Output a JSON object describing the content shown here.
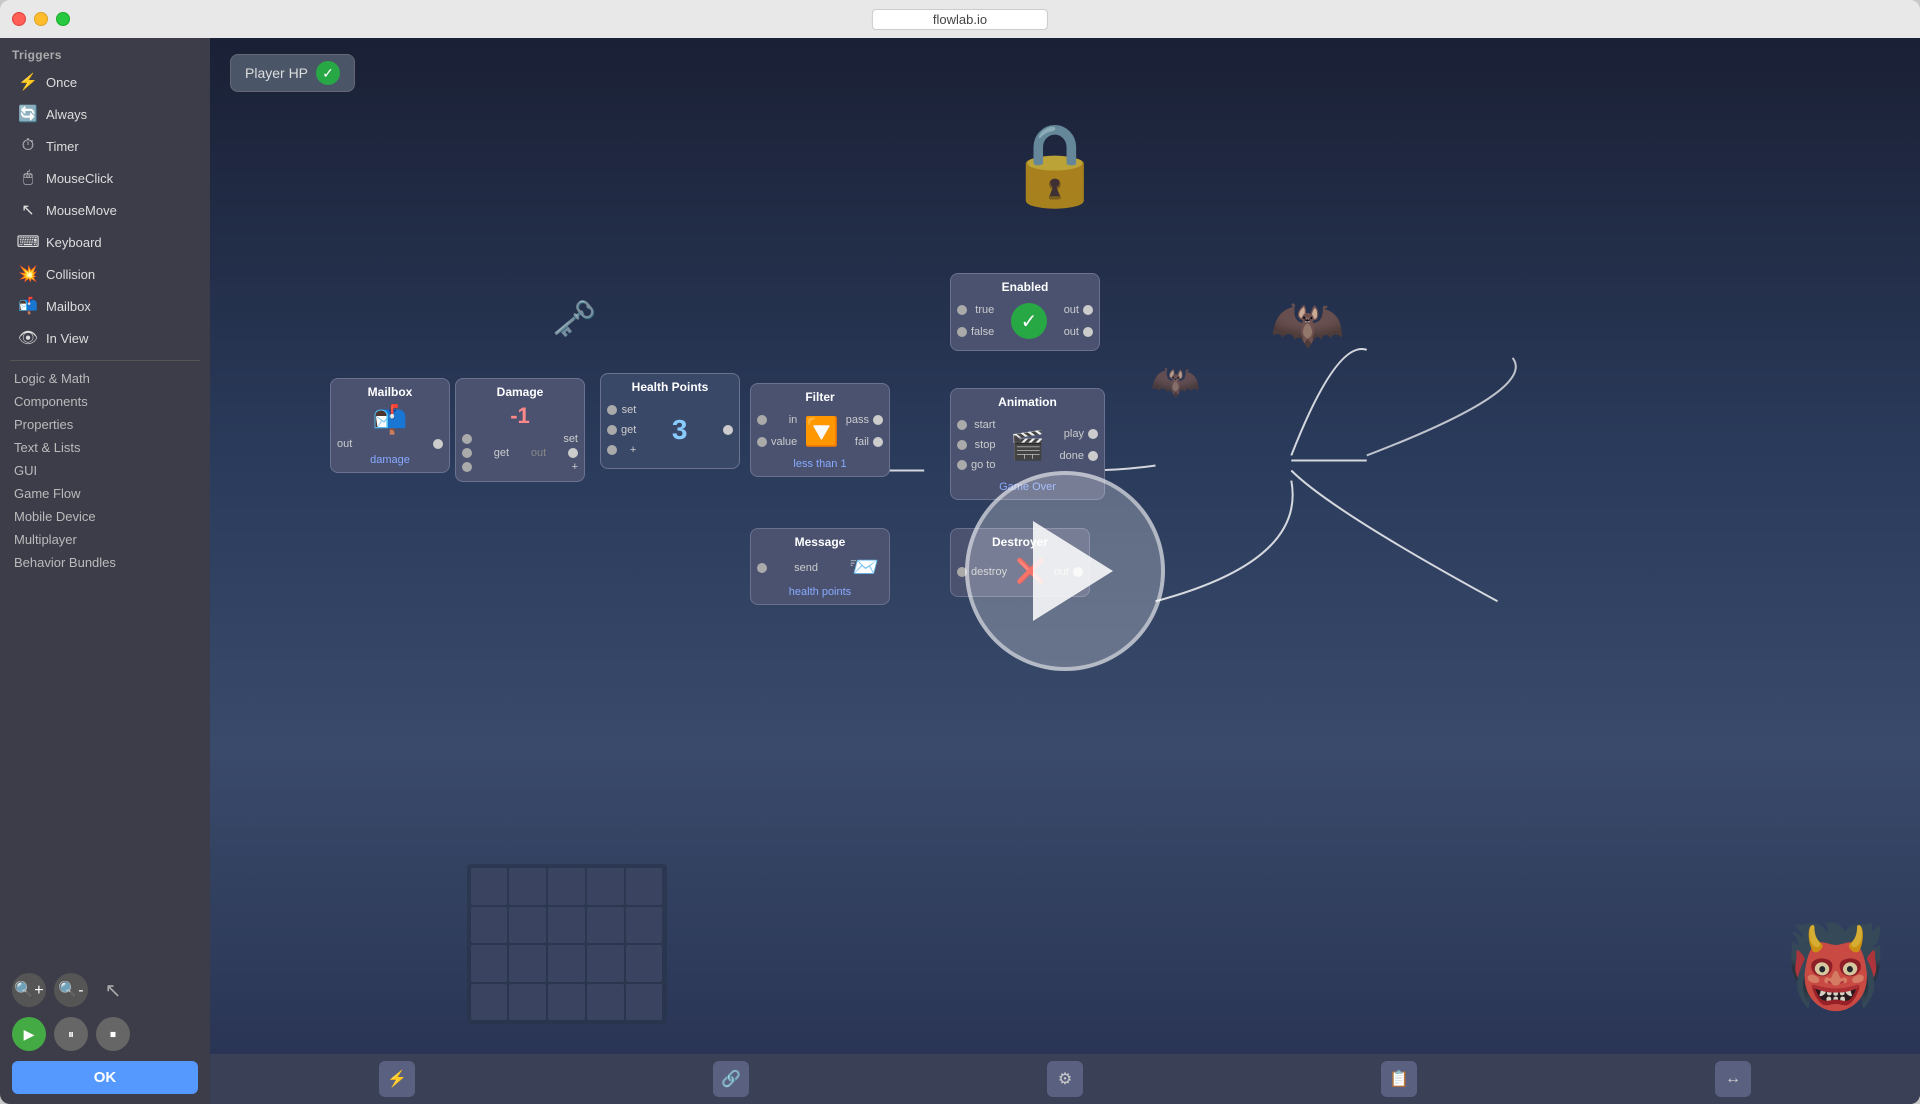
{
  "window": {
    "title": "flowlab.io"
  },
  "sidebar": {
    "triggers_label": "Triggers",
    "triggers": [
      {
        "id": "once",
        "label": "Once",
        "icon": "⚡"
      },
      {
        "id": "always",
        "label": "Always",
        "icon": "🔄"
      },
      {
        "id": "timer",
        "label": "Timer",
        "icon": "⏱"
      },
      {
        "id": "mouseclick",
        "label": "MouseClick",
        "icon": "🖱"
      },
      {
        "id": "mousemove",
        "label": "MouseMove",
        "icon": "↖"
      },
      {
        "id": "keyboard",
        "label": "Keyboard",
        "icon": "⌨"
      },
      {
        "id": "collision",
        "label": "Collision",
        "icon": "💥"
      },
      {
        "id": "mailbox",
        "label": "Mailbox",
        "icon": "📬"
      },
      {
        "id": "inview",
        "label": "In View",
        "icon": "👁"
      }
    ],
    "categories": [
      {
        "id": "logic-math",
        "label": "Logic & Math"
      },
      {
        "id": "components",
        "label": "Components"
      },
      {
        "id": "properties",
        "label": "Properties"
      },
      {
        "id": "text-lists",
        "label": "Text & Lists"
      },
      {
        "id": "gui",
        "label": "GUI"
      },
      {
        "id": "game-flow",
        "label": "Game Flow"
      },
      {
        "id": "mobile-device",
        "label": "Mobile Device"
      },
      {
        "id": "multiplayer",
        "label": "Multiplayer"
      },
      {
        "id": "behavior-bundles",
        "label": "Behavior Bundles"
      }
    ],
    "ok_button": "OK",
    "zoom_in_title": "Zoom In",
    "zoom_out_title": "Zoom Out"
  },
  "canvas": {
    "title": "Player HP",
    "nodes": {
      "mailbox": {
        "title": "Mailbox",
        "label": "damage",
        "port_out": "out"
      },
      "damage": {
        "title": "Damage",
        "ports": [
          "set",
          "get",
          "+"
        ],
        "value": "-1",
        "port_out": "out"
      },
      "health_points": {
        "title": "Health Points",
        "ports_in": [
          "set",
          "get",
          "+"
        ],
        "value": "3",
        "port_out": "out"
      },
      "filter": {
        "title": "Filter",
        "ports_in": [
          "in",
          "value"
        ],
        "ports_out": [
          "pass",
          "fail"
        ],
        "label": "less than 1"
      },
      "enabled": {
        "title": "Enabled",
        "ports_in": [
          "true",
          "false"
        ],
        "ports_out": [
          "out",
          "out"
        ]
      },
      "animation": {
        "title": "Animation",
        "ports_in": [
          "start",
          "stop",
          "go to"
        ],
        "ports_out": [
          "play",
          "done"
        ],
        "label": "Game Over"
      },
      "message": {
        "title": "Message",
        "port_in": "send",
        "label": "health points"
      },
      "destroyer": {
        "title": "Destroyer",
        "port_in": "destroy",
        "port_out": "out"
      }
    }
  }
}
